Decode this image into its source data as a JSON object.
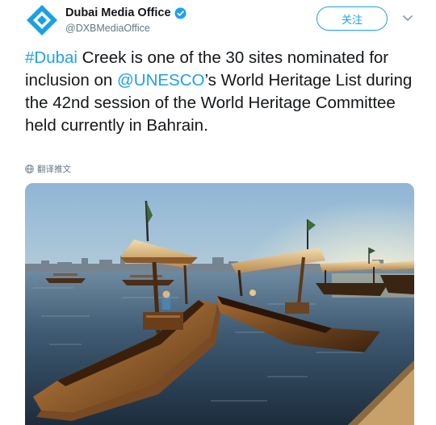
{
  "account": {
    "display_name": "Dubai Media Office",
    "handle": "@DXBMediaOffice",
    "verified": true,
    "avatar_icon": "dubai-media-office-logo-icon",
    "brand_color": "#1ba1e2"
  },
  "actions": {
    "follow_label": "关注",
    "menu_icon": "chevron-down-icon"
  },
  "tweet": {
    "hashtag": "#Dubai",
    "text_1": " Creek is one of the 30 sites nominated for inclusion on ",
    "mention": "@UNESCO",
    "text_2": "’s World Heritage List during the 42nd session of the World Heritage Committee held currently in Bahrain.",
    "link_color": "#1da1f2"
  },
  "translate": {
    "label": "翻译推文",
    "icon": "globe-icon"
  },
  "media": {
    "type": "photo",
    "subject": "abra-boats-on-dubai-creek"
  }
}
